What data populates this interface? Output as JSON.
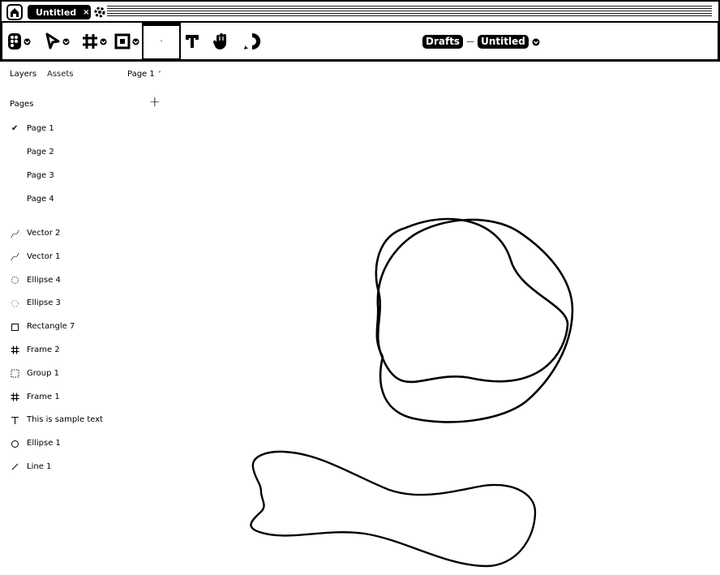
{
  "tabs": {
    "file_tab": "Untitled",
    "close": "×"
  },
  "breadcrumb": {
    "team": "Drafts",
    "file": "Untitled"
  },
  "toolbar": {
    "active_tool_glyph": "·"
  },
  "panel": {
    "layers_tab": "Layers",
    "assets_tab": "Assets",
    "page_selector": "Page 1",
    "pages_heading": "Pages",
    "add_page": "+",
    "pages": [
      {
        "name": "Page 1",
        "selected": true
      },
      {
        "name": "Page 2",
        "selected": false
      },
      {
        "name": "Page 3",
        "selected": false
      },
      {
        "name": "Page 4",
        "selected": false
      }
    ],
    "layers": [
      {
        "name": "Vector 2",
        "icon": "vector-icon"
      },
      {
        "name": "Vector 1",
        "icon": "vector-icon"
      },
      {
        "name": "Ellipse 4",
        "icon": "ellipse-icon"
      },
      {
        "name": "Ellipse 3",
        "icon": "ellipse-icon"
      },
      {
        "name": "Rectangle 7",
        "icon": "rectangle-icon"
      },
      {
        "name": "Frame 2",
        "icon": "frame-icon"
      },
      {
        "name": "Group 1",
        "icon": "group-icon"
      },
      {
        "name": "Frame 1",
        "icon": "frame-icon"
      },
      {
        "name": "This is sample text",
        "icon": "text-icon"
      },
      {
        "name": "Ellipse 1",
        "icon": "ellipse-icon"
      },
      {
        "name": "Line 1",
        "icon": "line-icon"
      }
    ]
  },
  "colors": {
    "ink": "#000000",
    "background": "#ffffff"
  }
}
